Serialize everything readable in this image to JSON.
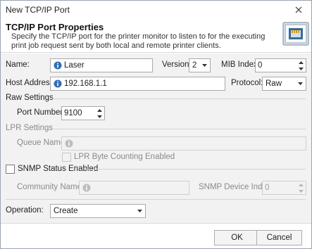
{
  "window": {
    "title": "New TCP/IP Port"
  },
  "header": {
    "title": "TCP/IP Port Properties",
    "description": "Specify the TCP/IP port for the printer monitor to listen to for the executing print job request sent by both local and remote printer clients.",
    "icon": "network-port-icon"
  },
  "fields": {
    "name": {
      "label": "Name:",
      "value": "Laser"
    },
    "version": {
      "label": "Version:",
      "value": "2"
    },
    "mib_index": {
      "label": "MIB Index:",
      "value": "0"
    },
    "host_address": {
      "label": "Host Address:",
      "value": "192.168.1.1"
    },
    "protocol": {
      "label": "Protocol:",
      "value": "Raw"
    }
  },
  "raw_settings": {
    "heading": "Raw Settings",
    "port_number": {
      "label": "Port Number:",
      "value": "9100"
    }
  },
  "lpr_settings": {
    "heading": "LPR Settings",
    "queue_name": {
      "label": "Queue Name:",
      "value": ""
    },
    "byte_counting": {
      "label": "LPR Byte Counting Enabled",
      "checked": false
    }
  },
  "snmp": {
    "enabled": {
      "label": "SNMP Status Enabled",
      "checked": false
    },
    "community_name": {
      "label": "Community Name:",
      "value": ""
    },
    "device_index": {
      "label": "SNMP Device Index:",
      "value": "0"
    }
  },
  "operation": {
    "label": "Operation:",
    "value": "Create"
  },
  "buttons": {
    "ok": "OK",
    "cancel": "Cancel"
  },
  "colors": {
    "info_icon": "#2f6fb6",
    "accent": "#0078d7"
  }
}
